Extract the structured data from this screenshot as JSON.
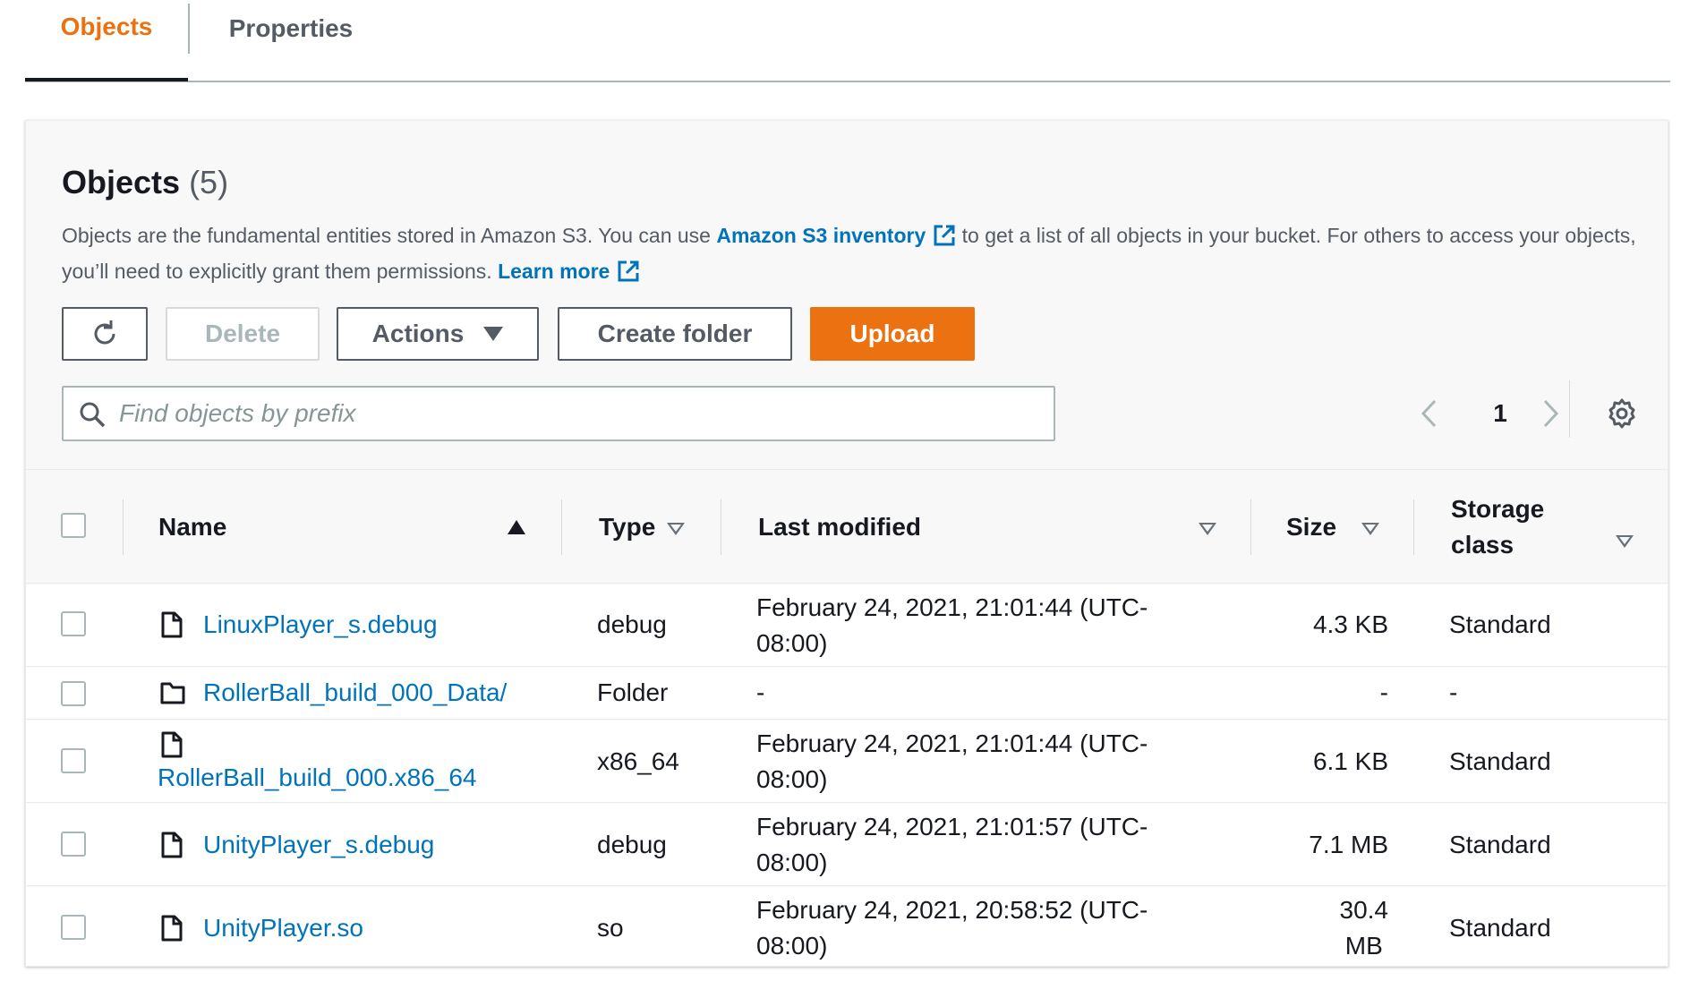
{
  "tabs": [
    {
      "label": "Objects",
      "active": true
    },
    {
      "label": "Properties",
      "active": false
    }
  ],
  "header": {
    "title": "Objects",
    "count": "(5)",
    "desc_part1": "Objects are the fundamental entities stored in Amazon S3. You can use ",
    "inventory_link": "Amazon S3 inventory",
    "desc_part2": " to get a list of all objects in your bucket. For others to access your objects, you’ll need to explicitly grant them permissions. ",
    "learn_more": "Learn more"
  },
  "toolbar": {
    "delete_label": "Delete",
    "actions_label": "Actions",
    "create_folder_label": "Create folder",
    "upload_label": "Upload"
  },
  "search": {
    "placeholder": "Find objects by prefix"
  },
  "pagination": {
    "current_page": "1"
  },
  "columns": {
    "name": "Name",
    "type": "Type",
    "last_modified": "Last modified",
    "size": "Size",
    "storage_line1": "Storage",
    "storage_line2": "class"
  },
  "rows": [
    {
      "icon": "file-icon",
      "name": "LinuxPlayer_s.debug",
      "type": "debug",
      "modified_line1": "February 24, 2021, 21:01:44 (UTC-",
      "modified_line2": "08:00)",
      "size_line1": "4.3 KB",
      "size_line2": "",
      "storage": "Standard"
    },
    {
      "icon": "folder-icon",
      "name": "RollerBall_build_000_Data/",
      "type": "Folder",
      "modified_line1": "-",
      "modified_line2": "",
      "size_line1": "-",
      "size_line2": "",
      "storage": "-"
    },
    {
      "icon": "file-icon",
      "name": "RollerBall_build_000.x86_64",
      "type": "x86_64",
      "modified_line1": "February 24, 2021, 21:01:44 (UTC-",
      "modified_line2": "08:00)",
      "size_line1": "6.1 KB",
      "size_line2": "",
      "storage": "Standard"
    },
    {
      "icon": "file-icon",
      "name": "UnityPlayer_s.debug",
      "type": "debug",
      "modified_line1": "February 24, 2021, 21:01:57 (UTC-",
      "modified_line2": "08:00)",
      "size_line1": "7.1 MB",
      "size_line2": "",
      "storage": "Standard"
    },
    {
      "icon": "file-icon",
      "name": "UnityPlayer.so",
      "type": "so",
      "modified_line1": "February 24, 2021, 20:58:52 (UTC-",
      "modified_line2": "08:00)",
      "size_line1": "30.4",
      "size_line2": "MB",
      "storage": "Standard"
    }
  ],
  "colors": {
    "accent": "#ec7211",
    "link": "#0073bb",
    "text": "#16191f",
    "muted": "#545b64"
  }
}
